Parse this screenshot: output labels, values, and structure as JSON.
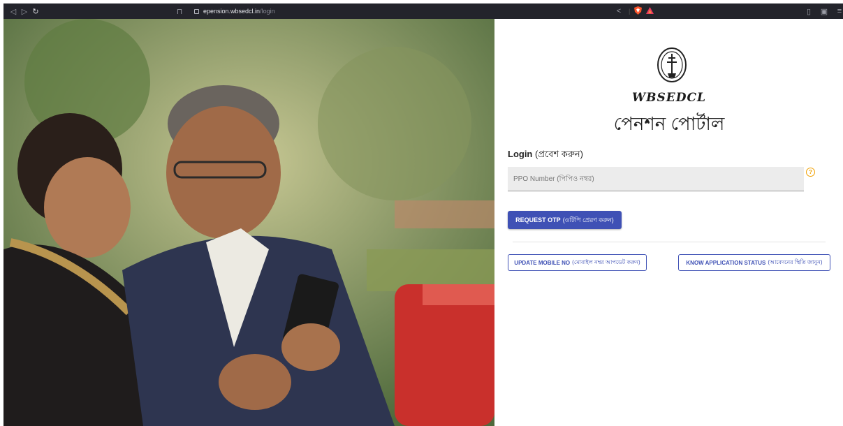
{
  "browser": {
    "url_host": "epension.wbsedcl.in",
    "url_path": "/login"
  },
  "logo": {
    "brand": "WBSEDCL",
    "subtitle": "পেনশন পোর্টাল"
  },
  "login": {
    "title_en": "Login",
    "title_bn": "(প্রবেশ করুন)",
    "ppo_placeholder": "PPO Number (পিপিও নম্বর)",
    "help_symbol": "?",
    "request_otp_en": "REQUEST OTP",
    "request_otp_bn": "(ওটিপি প্রেরণ করুন)",
    "update_mobile_en": "UPDATE MOBILE NO",
    "update_mobile_bn": "(মোবাইল নম্বর আপডেট করুন)",
    "know_status_en": "KNOW APPLICATION STATUS",
    "know_status_bn": "(আবেদনের স্থিতি জানুন)"
  },
  "colors": {
    "primary": "#3f51b5",
    "help": "#f0a000",
    "chrome": "#23242b"
  }
}
